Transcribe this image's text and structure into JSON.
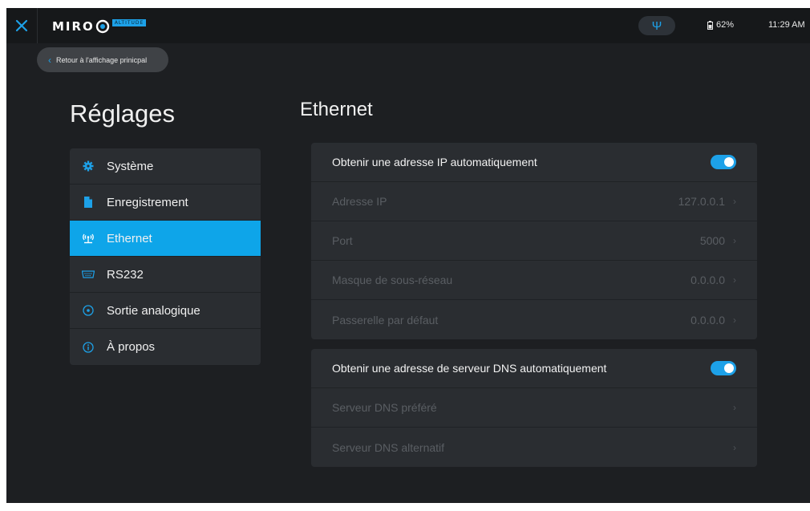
{
  "topbar": {
    "logo": "MIRO",
    "logo_badge": "ALTITUDE",
    "battery": "62%",
    "clock": "11:29 AM"
  },
  "back_label": "Retour à l'affichage prinicpal",
  "page_title": "Réglages",
  "section_title": "Ethernet",
  "sidebar": {
    "items": [
      {
        "label": "Système",
        "icon": "gear-icon"
      },
      {
        "label": "Enregistrement",
        "icon": "file-icon"
      },
      {
        "label": "Ethernet",
        "icon": "ethernet-icon",
        "active": true
      },
      {
        "label": "RS232",
        "icon": "serial-port-icon"
      },
      {
        "label": "Sortie analogique",
        "icon": "analog-output-icon"
      },
      {
        "label": "À propos",
        "icon": "info-icon"
      }
    ]
  },
  "ip_panel": {
    "toggle_label": "Obtenir une adresse IP automatiquement",
    "toggle_on": true,
    "rows": [
      {
        "label": "Adresse IP",
        "value": "127.0.0.1"
      },
      {
        "label": "Port",
        "value": "5000"
      },
      {
        "label": "Masque de sous-réseau",
        "value": "0.0.0.0"
      },
      {
        "label": "Passerelle par défaut",
        "value": "0.0.0.0"
      }
    ]
  },
  "dns_panel": {
    "toggle_label": "Obtenir une adresse de serveur DNS automatiquement",
    "toggle_on": true,
    "rows": [
      {
        "label": "Serveur DNS préféré",
        "value": ""
      },
      {
        "label": "Serveur DNS alternatif",
        "value": ""
      }
    ]
  },
  "colors": {
    "accent": "#1da1e8",
    "active_item": "#0ea5e9",
    "background": "#1d1f22",
    "panel": "#2a2d31"
  }
}
